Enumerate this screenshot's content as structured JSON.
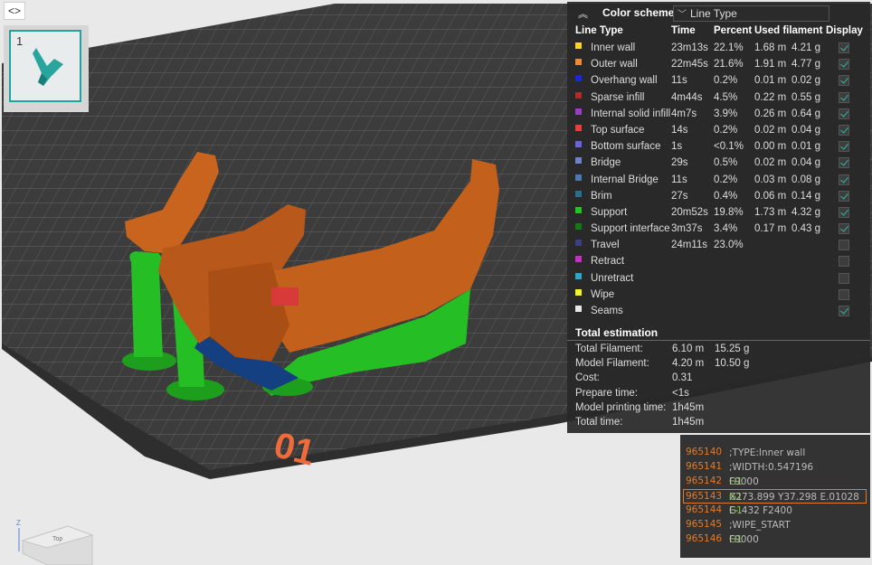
{
  "viewport": {
    "plate_label": "01",
    "collapse_glyph": "<>",
    "axis_label_z": "Z",
    "cube_face_label": "Top"
  },
  "plate_strip": {
    "plates": [
      {
        "number": "1",
        "selected": true
      }
    ]
  },
  "legend": {
    "color_scheme_label": "Color scheme",
    "color_scheme_value": "Line Type",
    "columns": {
      "line_type": "Line Type",
      "time": "Time",
      "percent": "Percent",
      "used_filament": "Used filament",
      "display": "Display"
    },
    "rows": [
      {
        "color": "#ffd22a",
        "name": "Inner wall",
        "time": "23m13s",
        "percent": "22.1%",
        "length": "1.68 m",
        "weight": "4.21 g",
        "display": true,
        "has_check": true
      },
      {
        "color": "#f08a30",
        "name": "Outer wall",
        "time": "22m45s",
        "percent": "21.6%",
        "length": "1.91 m",
        "weight": "4.77 g",
        "display": true,
        "has_check": true
      },
      {
        "color": "#1c25e6",
        "name": "Overhang wall",
        "time": "11s",
        "percent": "0.2%",
        "length": "0.01 m",
        "weight": "0.02 g",
        "display": true,
        "has_check": true
      },
      {
        "color": "#b02c2c",
        "name": "Sparse infill",
        "time": "4m44s",
        "percent": "4.5%",
        "length": "0.22 m",
        "weight": "0.55 g",
        "display": true,
        "has_check": true
      },
      {
        "color": "#9b3fc2",
        "name": "Internal solid infill",
        "time": "4m7s",
        "percent": "3.9%",
        "length": "0.26 m",
        "weight": "0.64 g",
        "display": true,
        "has_check": true
      },
      {
        "color": "#ee3b3b",
        "name": "Top surface",
        "time": "14s",
        "percent": "0.2%",
        "length": "0.02 m",
        "weight": "0.04 g",
        "display": true,
        "has_check": true
      },
      {
        "color": "#6c62dd",
        "name": "Bottom surface",
        "time": "1s",
        "percent": "<0.1%",
        "length": "0.00 m",
        "weight": "0.01 g",
        "display": true,
        "has_check": true
      },
      {
        "color": "#6d84c4",
        "name": "Bridge",
        "time": "29s",
        "percent": "0.5%",
        "length": "0.02 m",
        "weight": "0.04 g",
        "display": true,
        "has_check": true
      },
      {
        "color": "#4b78b4",
        "name": "Internal Bridge",
        "time": "11s",
        "percent": "0.2%",
        "length": "0.03 m",
        "weight": "0.08 g",
        "display": true,
        "has_check": true
      },
      {
        "color": "#2a6e8c",
        "name": "Brim",
        "time": "27s",
        "percent": "0.4%",
        "length": "0.06 m",
        "weight": "0.14 g",
        "display": true,
        "has_check": true
      },
      {
        "color": "#21c421",
        "name": "Support",
        "time": "20m52s",
        "percent": "19.8%",
        "length": "1.73 m",
        "weight": "4.32 g",
        "display": true,
        "has_check": true
      },
      {
        "color": "#147a14",
        "name": "Support interface",
        "time": "3m37s",
        "percent": "3.4%",
        "length": "0.17 m",
        "weight": "0.43 g",
        "display": true,
        "has_check": true
      },
      {
        "color": "#3b3f8a",
        "name": "Travel",
        "time": "24m11s",
        "percent": "23.0%",
        "length": "",
        "weight": "",
        "display": false,
        "has_check": true
      },
      {
        "color": "#c42fc4",
        "name": "Retract",
        "time": "",
        "percent": "",
        "length": "",
        "weight": "",
        "display": false,
        "has_check": true
      },
      {
        "color": "#2aa7c9",
        "name": "Unretract",
        "time": "",
        "percent": "",
        "length": "",
        "weight": "",
        "display": false,
        "has_check": true
      },
      {
        "color": "#f4f42a",
        "name": "Wipe",
        "time": "",
        "percent": "",
        "length": "",
        "weight": "",
        "display": false,
        "has_check": true
      },
      {
        "color": "#e8e8e8",
        "name": "Seams",
        "time": "",
        "percent": "",
        "length": "",
        "weight": "",
        "display": true,
        "has_check": true
      }
    ],
    "total_title": "Total estimation",
    "estimation": [
      {
        "key": "Total Filament:",
        "v1": "6.10 m",
        "v2": "15.25 g"
      },
      {
        "key": "Model Filament:",
        "v1": "4.20 m",
        "v2": "10.50 g"
      },
      {
        "key": "Cost:",
        "v1": "0.31",
        "v2": ""
      },
      {
        "key": "Prepare time:",
        "v1": "<1s",
        "v2": ""
      },
      {
        "key": "Model printing time:",
        "v1": "1h45m",
        "v2": ""
      },
      {
        "key": "Total time:",
        "v1": "1h45m",
        "v2": ""
      }
    ]
  },
  "gcode": {
    "lines": [
      {
        "num": "965140",
        "kw": "",
        "text": ";TYPE:Inner wall",
        "highlight": false
      },
      {
        "num": "965141",
        "kw": "",
        "text": ";WIDTH:0.547196",
        "highlight": false
      },
      {
        "num": "965142",
        "kw": "G1",
        "text": " F9000",
        "highlight": false
      },
      {
        "num": "965143",
        "kw": "G1",
        "text": " X273.899 Y37.298 E.01028",
        "highlight": true
      },
      {
        "num": "965144",
        "kw": "G1",
        "text": " E-.432 F2400",
        "highlight": false
      },
      {
        "num": "965145",
        "kw": "",
        "text": ";WIPE_START",
        "highlight": false
      },
      {
        "num": "965146",
        "kw": "G1",
        "text": " F9000",
        "highlight": false
      }
    ]
  }
}
